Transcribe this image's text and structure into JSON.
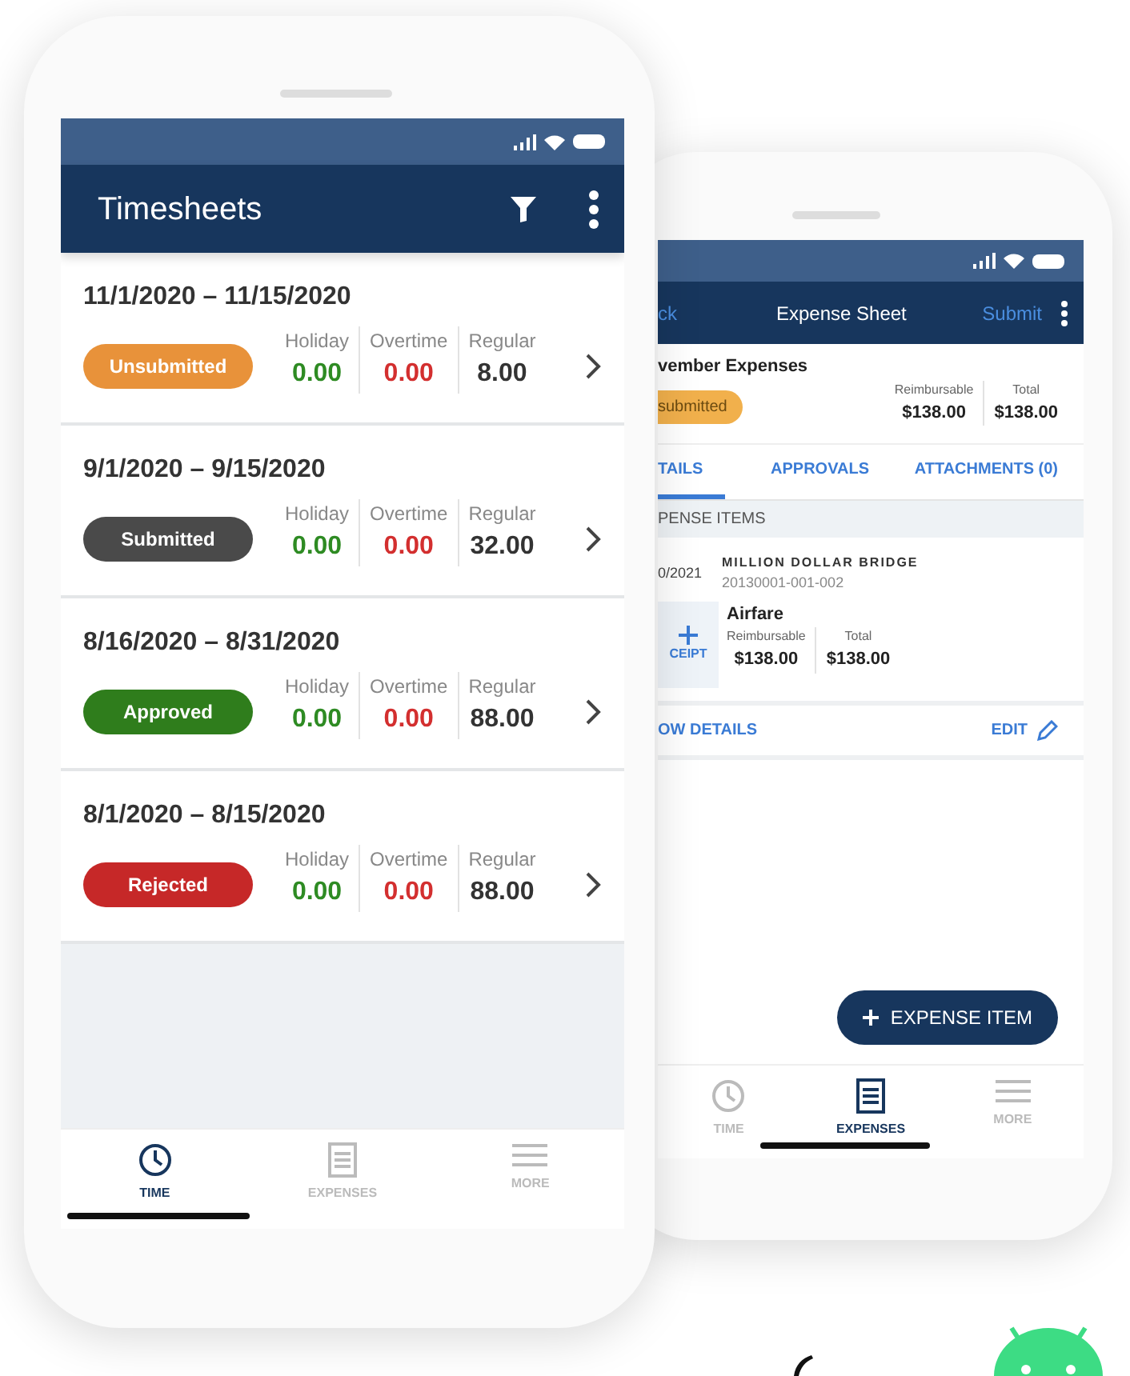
{
  "timesheets_phone": {
    "title": "Timesheets",
    "timesheets": [
      {
        "period": "11/1/2020 – 11/15/2020",
        "status": "Unsubmitted",
        "color": "#e8923a",
        "holiday_label": "Holiday",
        "holiday": "0.00",
        "overtime_label": "Overtime",
        "overtime": "0.00",
        "regular_label": "Regular",
        "regular": "8.00"
      },
      {
        "period": "9/1/2020 – 9/15/2020",
        "status": "Submitted",
        "color": "#4a4a4a",
        "holiday_label": "Holiday",
        "holiday": "0.00",
        "overtime_label": "Overtime",
        "overtime": "0.00",
        "regular_label": "Regular",
        "regular": "32.00"
      },
      {
        "period": "8/16/2020 – 8/31/2020",
        "status": "Approved",
        "color": "#2f7d1c",
        "holiday_label": "Holiday",
        "holiday": "0.00",
        "overtime_label": "Overtime",
        "overtime": "0.00",
        "regular_label": "Regular",
        "regular": "88.00"
      },
      {
        "period": "8/1/2020 – 8/15/2020",
        "status": "Rejected",
        "color": "#c62828",
        "holiday_label": "Holiday",
        "holiday": "0.00",
        "overtime_label": "Overtime",
        "overtime": "0.00",
        "regular_label": "Regular",
        "regular": "88.00"
      }
    ],
    "nav": [
      {
        "label": "TIME",
        "kind": "clock",
        "selected": true
      },
      {
        "label": "EXPENSES",
        "kind": "sheet",
        "selected": false
      },
      {
        "label": "MORE",
        "kind": "menu",
        "selected": false
      }
    ]
  },
  "expense_phone": {
    "back": "ck",
    "title": "Expense Sheet",
    "submit": "Submit",
    "sheet_name": "vember Expenses",
    "status": "submitted",
    "reimbursable_label": "Reimbursable",
    "reimbursable": "$138.00",
    "total_label": "Total",
    "total": "$138.00",
    "tabs": [
      {
        "label": "TAILS",
        "selected": true
      },
      {
        "label": "APPROVALS",
        "selected": false
      },
      {
        "label": "ATTACHMENTS (0)",
        "selected": false
      }
    ],
    "section": "PENSE ITEMS",
    "item": {
      "date": "0/2021",
      "project": "MILLION DOLLAR BRIDGE",
      "code": "20130001-001-002",
      "receipt": "CEIPT",
      "category": "Airfare",
      "reimbursable_label": "Reimbursable",
      "reimbursable": "$138.00",
      "total_label": "Total",
      "total": "$138.00"
    },
    "show_details": "OW DETAILS",
    "edit": "EDIT",
    "fab": "EXPENSE ITEM",
    "nav": [
      {
        "label": "TIME",
        "kind": "clock",
        "selected": false
      },
      {
        "label": "EXPENSES",
        "kind": "sheet",
        "selected": true
      },
      {
        "label": "MORE",
        "kind": "menu",
        "selected": false
      }
    ]
  }
}
